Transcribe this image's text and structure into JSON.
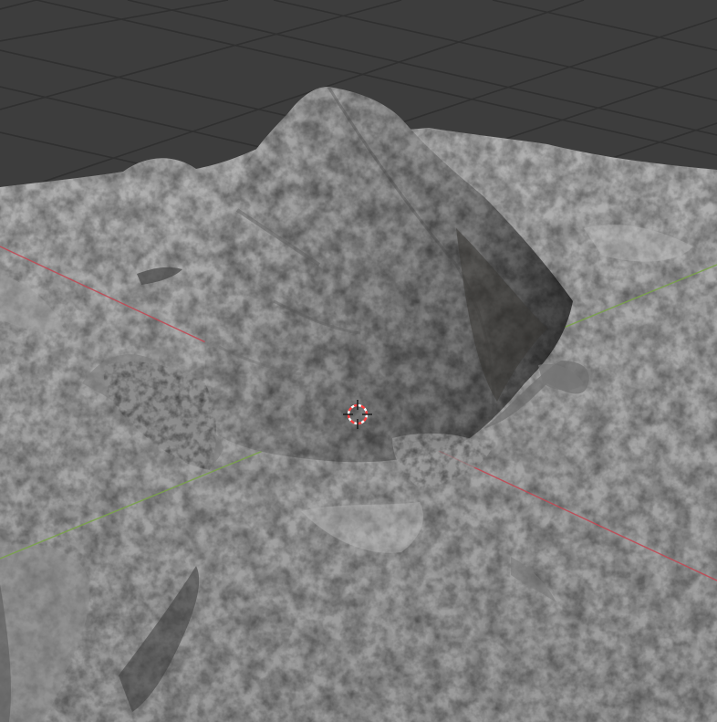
{
  "viewport": {
    "background_color": "#3d3d3d",
    "grid_line_color": "#303030",
    "mesh_light_color": "#bdbdbd",
    "mesh_mid_color": "#8f8f8f",
    "mesh_shadow_color": "#4a4a4a",
    "x_axis_color": "#c24a55",
    "y_axis_color": "#7aa34a",
    "cursor_colors": [
      "#ff4040",
      "#ffffff"
    ],
    "cursor_icon": "3d-cursor-icon"
  }
}
